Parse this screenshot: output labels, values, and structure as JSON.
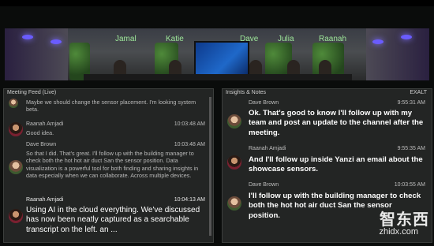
{
  "room": {
    "participants": [
      "Jamal",
      "Katie",
      "Dave",
      "Julia",
      "Raanah"
    ]
  },
  "meeting_feed": {
    "title": "Meeting Feed (Live)",
    "messages": [
      {
        "sender": "",
        "time": "",
        "text": "Maybe we should change the sensor placement. I'm looking system beta."
      },
      {
        "sender": "Raanah Amjadi",
        "time": "10:03:48 AM",
        "text": "Good idea."
      },
      {
        "sender": "Dave Brown",
        "time": "10:03:48 AM",
        "text": "So that I did. That's great. I'll follow up with the building manager to check both the hot hot air duct San the sensor position. Data visualization is a powerful tool for both finding and sharing insights in data especially when we can collaborate. Across multiple devices."
      },
      {
        "sender": "Raanah Amjadi",
        "time": "10:04:13 AM",
        "text": "Using AI in the cloud everything. We've discussed has now been neatly captured as a searchable transcript on the left. an ..."
      }
    ]
  },
  "insights": {
    "title": "Insights & Notes",
    "tag": "EXALT",
    "messages": [
      {
        "sender": "Dave Brown",
        "time": "9:55:31 AM",
        "text": "Ok. That's good to know I'll follow up with my team and post an update to the channel after the meeting."
      },
      {
        "sender": "Raanah Amjadi",
        "time": "9:55:35 AM",
        "text": "And I'll follow up inside Yanzi an email about the showcase sensors."
      },
      {
        "sender": "Dave Brown",
        "time": "10:03:55 AM",
        "text": "I'll follow up with the building manager to check both the hot hot air duct San the sensor position."
      }
    ]
  },
  "watermark": {
    "cn": "智东西",
    "url": "zhidx.com"
  }
}
